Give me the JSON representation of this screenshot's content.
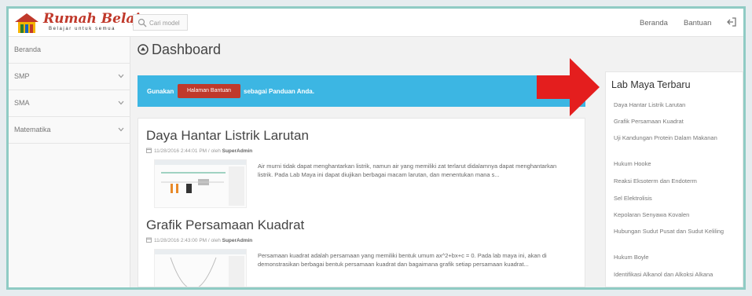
{
  "brand": {
    "title": "Rumah Belajar",
    "tagline": "Belajar untuk semua"
  },
  "search": {
    "placeholder": "Cari model"
  },
  "topnav": {
    "home": "Beranda",
    "help": "Bantuan"
  },
  "sidebar": {
    "items": [
      {
        "label": "Beranda",
        "has_chevron": false
      },
      {
        "label": "SMP",
        "has_chevron": true
      },
      {
        "label": "SMA",
        "has_chevron": true
      },
      {
        "label": "Matematika",
        "has_chevron": true
      }
    ]
  },
  "page": {
    "title": "Dashboard"
  },
  "banner": {
    "prefix": "Gunakan",
    "button": "Halaman Bantuan",
    "suffix": "sebagai Panduan Anda."
  },
  "posts": [
    {
      "title": "Daya Hantar Listrik Larutan",
      "date": "11/28/2016 2:44:01 PM / oleh",
      "author": "SuperAdmin",
      "body": "Air murni tidak dapat menghantarkan listrik, namun air yang memiliki zat terlarut didalamnya dapat menghantarkan listrik. Pada Lab Maya ini dapat diujikan berbagai macam larutan, dan menentukan mana s..."
    },
    {
      "title": "Grafik Persamaan Kuadrat",
      "date": "11/28/2016 2:43:00 PM / oleh",
      "author": "SuperAdmin",
      "body": "Persamaan kuadrat adalah persamaan yang memiliki bentuk umum ax^2+bx+c = 0. Pada lab maya ini, akan di demonstrasikan berbagai bentuk persamaan kuadrat dan bagaimana grafik setiap persamaan kuadrat..."
    }
  ],
  "latest": {
    "title": "Lab Maya Terbaru",
    "items": [
      "Daya Hantar Listrik Larutan",
      "Grafik Persamaan Kuadrat",
      "Uji Kandungan Protein Dalam Makanan",
      "Hukum Hooke",
      "Reaksi Eksoterm dan Endoterm",
      "Sel Elektrolisis",
      "Kepolaran Senyawa Kovalen",
      "Hubungan Sudut Pusat dan Sudut Keliling",
      "Hukum Boyle",
      "Identifikasi Alkanol dan Alkoksi Alkana"
    ]
  },
  "colors": {
    "accent": "#3cb6e3",
    "brand": "#c0392b",
    "frame": "#8fcbc4",
    "arrow": "#e41e1e"
  }
}
